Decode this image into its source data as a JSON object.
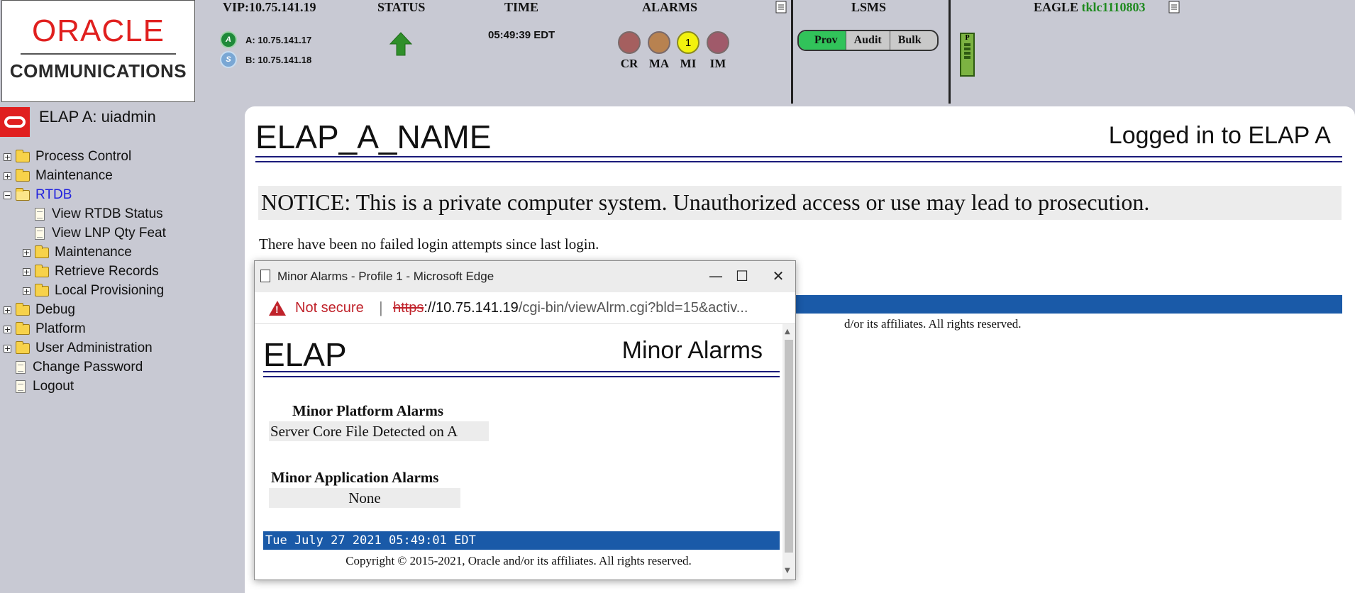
{
  "header": {
    "logo_brand": "ORACLE",
    "logo_sub": "COMMUNICATIONS",
    "vip_label": "VIP:10.75.141.19",
    "servers": [
      {
        "badge": "A",
        "text": "A: 10.75.141.17",
        "color": "#1f8a3a"
      },
      {
        "badge": "S",
        "text": "B: 10.75.141.18",
        "color": "#7aa7d4"
      }
    ],
    "status_label": "STATUS",
    "time_label": "TIME",
    "time_value": "05:49:39 EDT",
    "alarms_label": "ALARMS",
    "alarms": [
      {
        "label": "CR",
        "value": "",
        "color": "#a55f5f"
      },
      {
        "label": "MA",
        "value": "",
        "color": "#b88250"
      },
      {
        "label": "MI",
        "value": "1",
        "color": "#f2f20e"
      },
      {
        "label": "IM",
        "value": "",
        "color": "#a05a6a"
      }
    ],
    "lsms_label": "LSMS",
    "lsms_buttons": [
      "Prov",
      "Audit",
      "Bulk"
    ],
    "eagle_label": "EAGLE",
    "eagle_name": "tklc1110803",
    "eagle_badge": "P"
  },
  "sidebar": {
    "user_title": "ELAP A: uiadmin",
    "items": [
      {
        "label": "Process Control",
        "toggle": "+",
        "icon": "folder"
      },
      {
        "label": "Maintenance",
        "toggle": "+",
        "icon": "folder"
      },
      {
        "label": "RTDB",
        "toggle": "−",
        "icon": "folder-open"
      },
      {
        "label": "View RTDB Status",
        "toggle": "",
        "icon": "page"
      },
      {
        "label": "View LNP Qty Feat",
        "toggle": "",
        "icon": "page"
      },
      {
        "label": "Maintenance",
        "toggle": "+",
        "icon": "folder"
      },
      {
        "label": "Retrieve Records",
        "toggle": "+",
        "icon": "folder"
      },
      {
        "label": "Local Provisioning",
        "toggle": "+",
        "icon": "folder"
      },
      {
        "label": "Debug",
        "toggle": "+",
        "icon": "folder"
      },
      {
        "label": "Platform",
        "toggle": "+",
        "icon": "folder"
      },
      {
        "label": "User Administration",
        "toggle": "+",
        "icon": "folder"
      },
      {
        "label": "Change Password",
        "toggle": "",
        "icon": "page"
      },
      {
        "label": "Logout",
        "toggle": "",
        "icon": "page"
      }
    ]
  },
  "main": {
    "title": "ELAP_A_NAME",
    "login_info": "Logged in to ELAP A",
    "notice": "NOTICE: This is a private computer system. Unauthorized access or use may lead to prosecution.",
    "failed_login": "There have been no failed login attempts since last login.",
    "copyright_partial": "d/or its affiliates. All rights reserved."
  },
  "popup": {
    "window_title": "Minor Alarms - Profile 1 - Microsoft Edge",
    "not_secure": "Not secure",
    "url_scheme": "https",
    "url_host": "://10.75.141.19",
    "url_path": "/cgi-bin/viewAlrm.cgi?bld=15&activ...",
    "app_name": "ELAP",
    "heading": "Minor Alarms",
    "platform_header": "Minor Platform Alarms",
    "platform_alarm": "Server Core File Detected on A",
    "application_header": "Minor Application Alarms",
    "application_alarm": "None",
    "timestamp": "Tue July 27 2021 05:49:01 EDT",
    "copyright": "Copyright © 2015-2021, Oracle and/or its affiliates. All rights reserved."
  }
}
